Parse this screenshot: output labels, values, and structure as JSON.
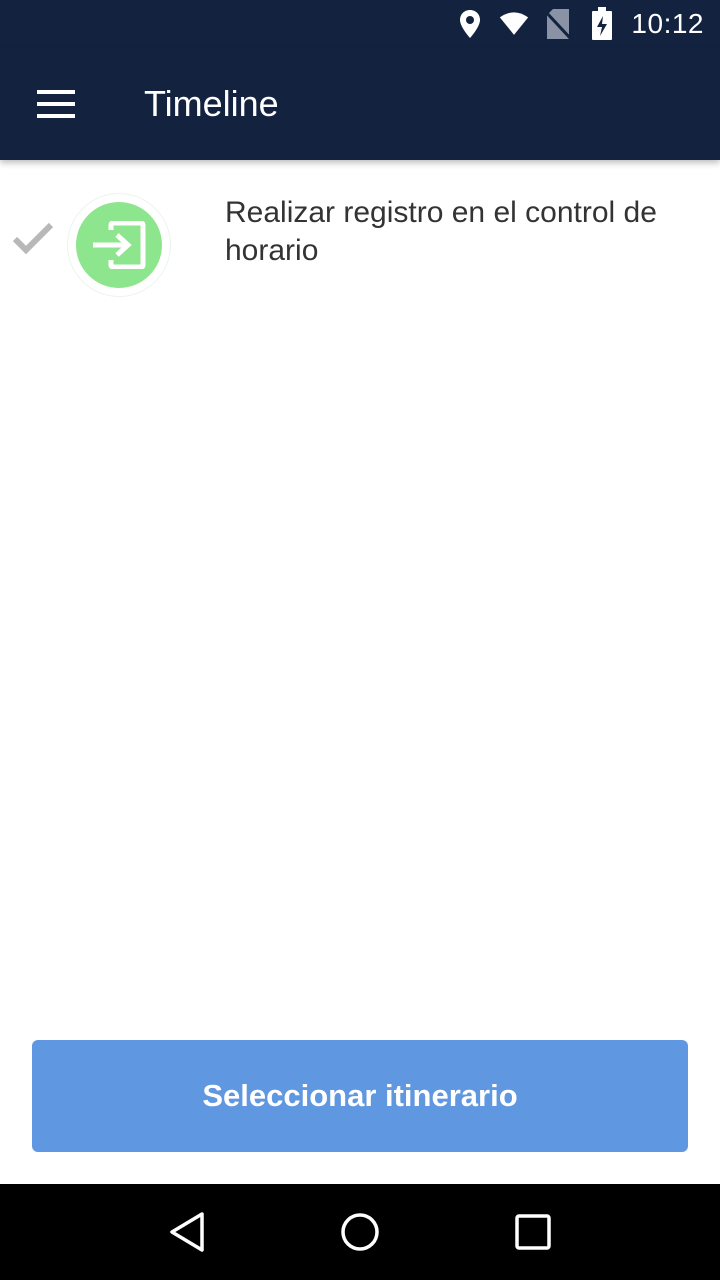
{
  "status_bar": {
    "time": "10:12",
    "icons": [
      "location-icon",
      "wifi-icon",
      "no-sim-icon",
      "battery-charging-icon"
    ]
  },
  "app_bar": {
    "menu_icon": "hamburger-menu-icon",
    "title": "Timeline"
  },
  "timeline": {
    "items": [
      {
        "status_icon": "check-icon",
        "icon": "login-enter-icon",
        "icon_color": "#8de58d",
        "text": "Realizar registro en el control de horario"
      }
    ]
  },
  "actions": {
    "select_itinerary_label": "Seleccionar itinerario",
    "button_color": "#5f97e0"
  },
  "nav_bar": {
    "buttons": [
      "back-icon",
      "home-icon",
      "recents-icon"
    ]
  },
  "colors": {
    "primary_dark": "#13223f",
    "accent_blue": "#5f97e0",
    "success_green": "#8de58d"
  }
}
